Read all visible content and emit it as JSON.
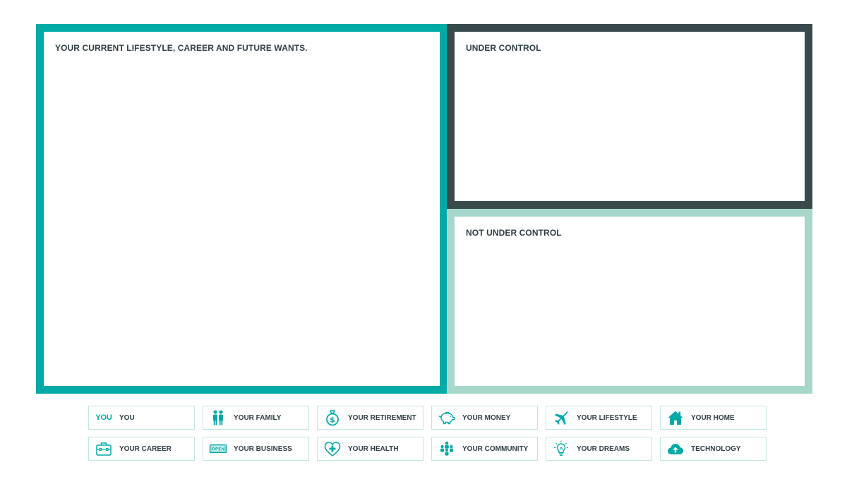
{
  "panels": {
    "left": {
      "title": "YOUR CURRENT LIFESTYLE, CAREER AND FUTURE WANTS.",
      "border_color": "#00aaa7"
    },
    "top_right": {
      "title": "UNDER CONTROL",
      "border_color": "#394a4d"
    },
    "bottom_right": {
      "title": "NOT UNDER CONTROL",
      "border_color": "#a7d7ca"
    }
  },
  "accent_color": "#00aaa7",
  "categories": [
    {
      "label": "YOU",
      "icon": "you-text-icon",
      "icon_text": "YOU"
    },
    {
      "label": "YOUR FAMILY",
      "icon": "family-icon"
    },
    {
      "label": "YOUR RETIREMENT",
      "icon": "money-bag-icon"
    },
    {
      "label": "YOUR MONEY",
      "icon": "piggy-bank-icon"
    },
    {
      "label": "YOUR LIFESTYLE",
      "icon": "airplane-icon"
    },
    {
      "label": "YOUR HOME",
      "icon": "house-icon"
    },
    {
      "label": "YOUR CAREER",
      "icon": "briefcase-icon"
    },
    {
      "label": "YOUR BUSINESS",
      "icon": "open-sign-icon",
      "icon_text": "OPEN"
    },
    {
      "label": "YOUR HEALTH",
      "icon": "heart-plus-icon"
    },
    {
      "label": "YOUR COMMUNITY",
      "icon": "community-icon"
    },
    {
      "label": "YOUR DREAMS",
      "icon": "lightbulb-icon"
    },
    {
      "label": "TECHNOLOGY",
      "icon": "cloud-upload-icon"
    }
  ]
}
